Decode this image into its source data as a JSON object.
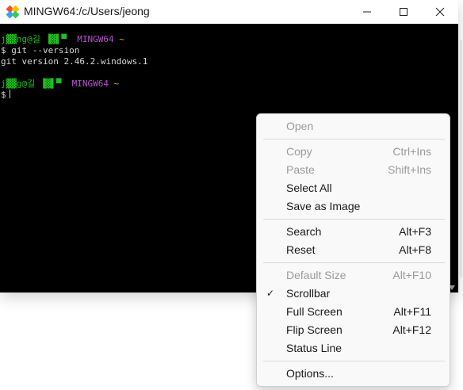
{
  "window": {
    "title": "MINGW64:/c/Users/jeong"
  },
  "terminal": {
    "line1_user": "j▓▓ng@길 ▐▓▌▀",
    "line1_env": "MINGW64",
    "line1_path": "~",
    "line2": "$ git --version",
    "line3": "git version 2.46.2.windows.1",
    "line5_user": "j▓▓g@길 ▐▓▌▀",
    "line5_env": "MINGW64",
    "line5_path": "~",
    "line6": "$"
  },
  "context_menu": {
    "open": "Open",
    "copy": "Copy",
    "copy_shortcut": "Ctrl+Ins",
    "paste": "Paste",
    "paste_shortcut": "Shift+Ins",
    "select_all": "Select All",
    "save_as_image": "Save as Image",
    "search": "Search",
    "search_shortcut": "Alt+F3",
    "reset": "Reset",
    "reset_shortcut": "Alt+F8",
    "default_size": "Default Size",
    "default_size_shortcut": "Alt+F10",
    "scrollbar": "Scrollbar",
    "scrollbar_check": "✓",
    "full_screen": "Full Screen",
    "full_screen_shortcut": "Alt+F11",
    "flip_screen": "Flip Screen",
    "flip_screen_shortcut": "Alt+F12",
    "status_line": "Status Line",
    "options": "Options..."
  },
  "colors": {
    "terminal_bg": "#000000",
    "prompt_user": "#1fbf1f",
    "prompt_env": "#b84fcf",
    "menu_disabled": "#9b9b9b"
  }
}
